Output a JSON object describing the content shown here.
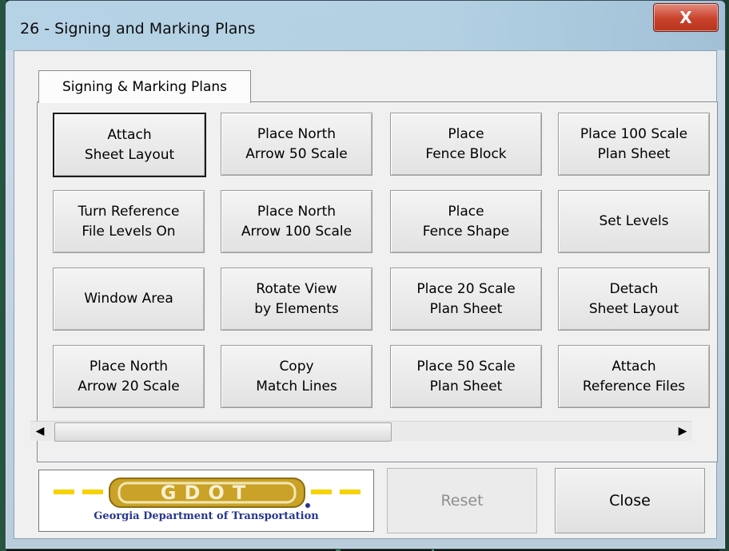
{
  "window": {
    "title": "26 - Signing and Marking Plans",
    "close_glyph": "X"
  },
  "tabs": [
    {
      "label": "Signing & Marking Plans",
      "selected": true
    }
  ],
  "buttons": [
    {
      "label": "Attach\nSheet Layout",
      "default": true
    },
    {
      "label": "Place North\nArrow 50 Scale"
    },
    {
      "label": "Place\nFence Block"
    },
    {
      "label": "Place 100 Scale\nPlan Sheet"
    },
    {
      "label": "Turn Reference\nFile Levels On"
    },
    {
      "label": "Place North\nArrow 100 Scale"
    },
    {
      "label": "Place\nFence Shape"
    },
    {
      "label": "Set Levels"
    },
    {
      "label": "Window Area"
    },
    {
      "label": "Rotate View\nby Elements"
    },
    {
      "label": "Place 20 Scale\nPlan Sheet"
    },
    {
      "label": "Detach\nSheet Layout"
    },
    {
      "label": "Place North\nArrow 20 Scale"
    },
    {
      "label": "Copy\nMatch Lines"
    },
    {
      "label": "Place 50 Scale\nPlan Sheet"
    },
    {
      "label": "Attach\nReference Files"
    }
  ],
  "scrollbar": {
    "left_arrow": "◀",
    "right_arrow": "▶",
    "position": 0
  },
  "logo": {
    "name": "GDOT",
    "caption": "Georgia Department of Transportation",
    "colors": {
      "gold": "#c9a227",
      "yellow": "#f5d200",
      "blue": "#26368f"
    }
  },
  "footer": {
    "reset_label": "Reset",
    "reset_enabled": false,
    "close_label": "Close"
  }
}
